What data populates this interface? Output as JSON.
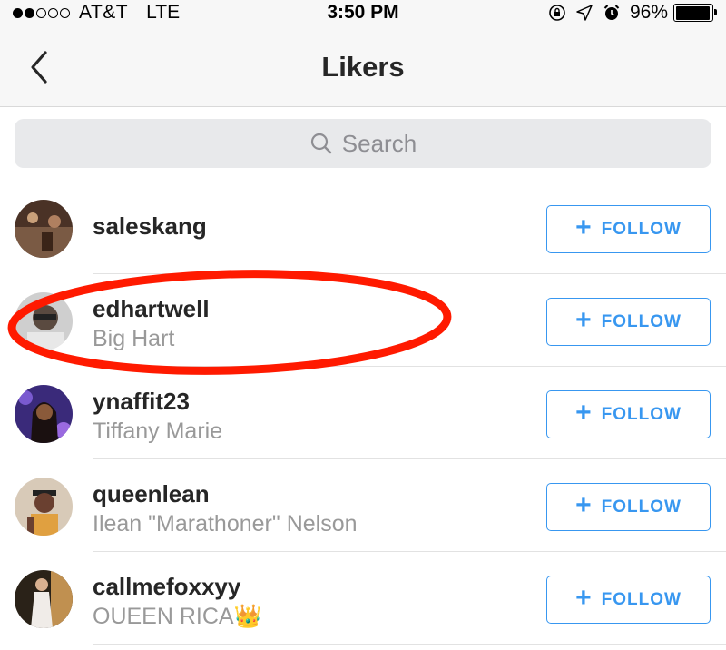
{
  "status_bar": {
    "carrier": "AT&T",
    "network": "LTE",
    "time": "3:50 PM",
    "battery": "96%",
    "battery_level": 0.96,
    "signal_bars": 2,
    "signal_total": 5
  },
  "nav": {
    "title": "Likers",
    "back_icon": "chevron-left-icon"
  },
  "search": {
    "placeholder": "Search",
    "icon": "search-icon"
  },
  "follow_label": "FOLLOW",
  "likers": [
    {
      "username": "saleskang",
      "fullname": "",
      "avatar_color": "#6b4a3a"
    },
    {
      "username": "edhartwell",
      "fullname": "Big Hart",
      "avatar_color": "#8a8a8a"
    },
    {
      "username": "ynaffit23",
      "fullname": "Tiffany Marie",
      "avatar_color": "#5a3fa0"
    },
    {
      "username": "queenlean",
      "fullname": "Ilean \"Marathoner\" Nelson",
      "avatar_color": "#b8a58c"
    },
    {
      "username": "callmefoxxyy",
      "fullname": "OUEEN RICA👑",
      "avatar_color": "#d9a97a"
    }
  ],
  "colors": {
    "accent": "#3897f0",
    "annotation": "#ff1a00",
    "text_primary": "#262626",
    "text_secondary": "#999999"
  }
}
